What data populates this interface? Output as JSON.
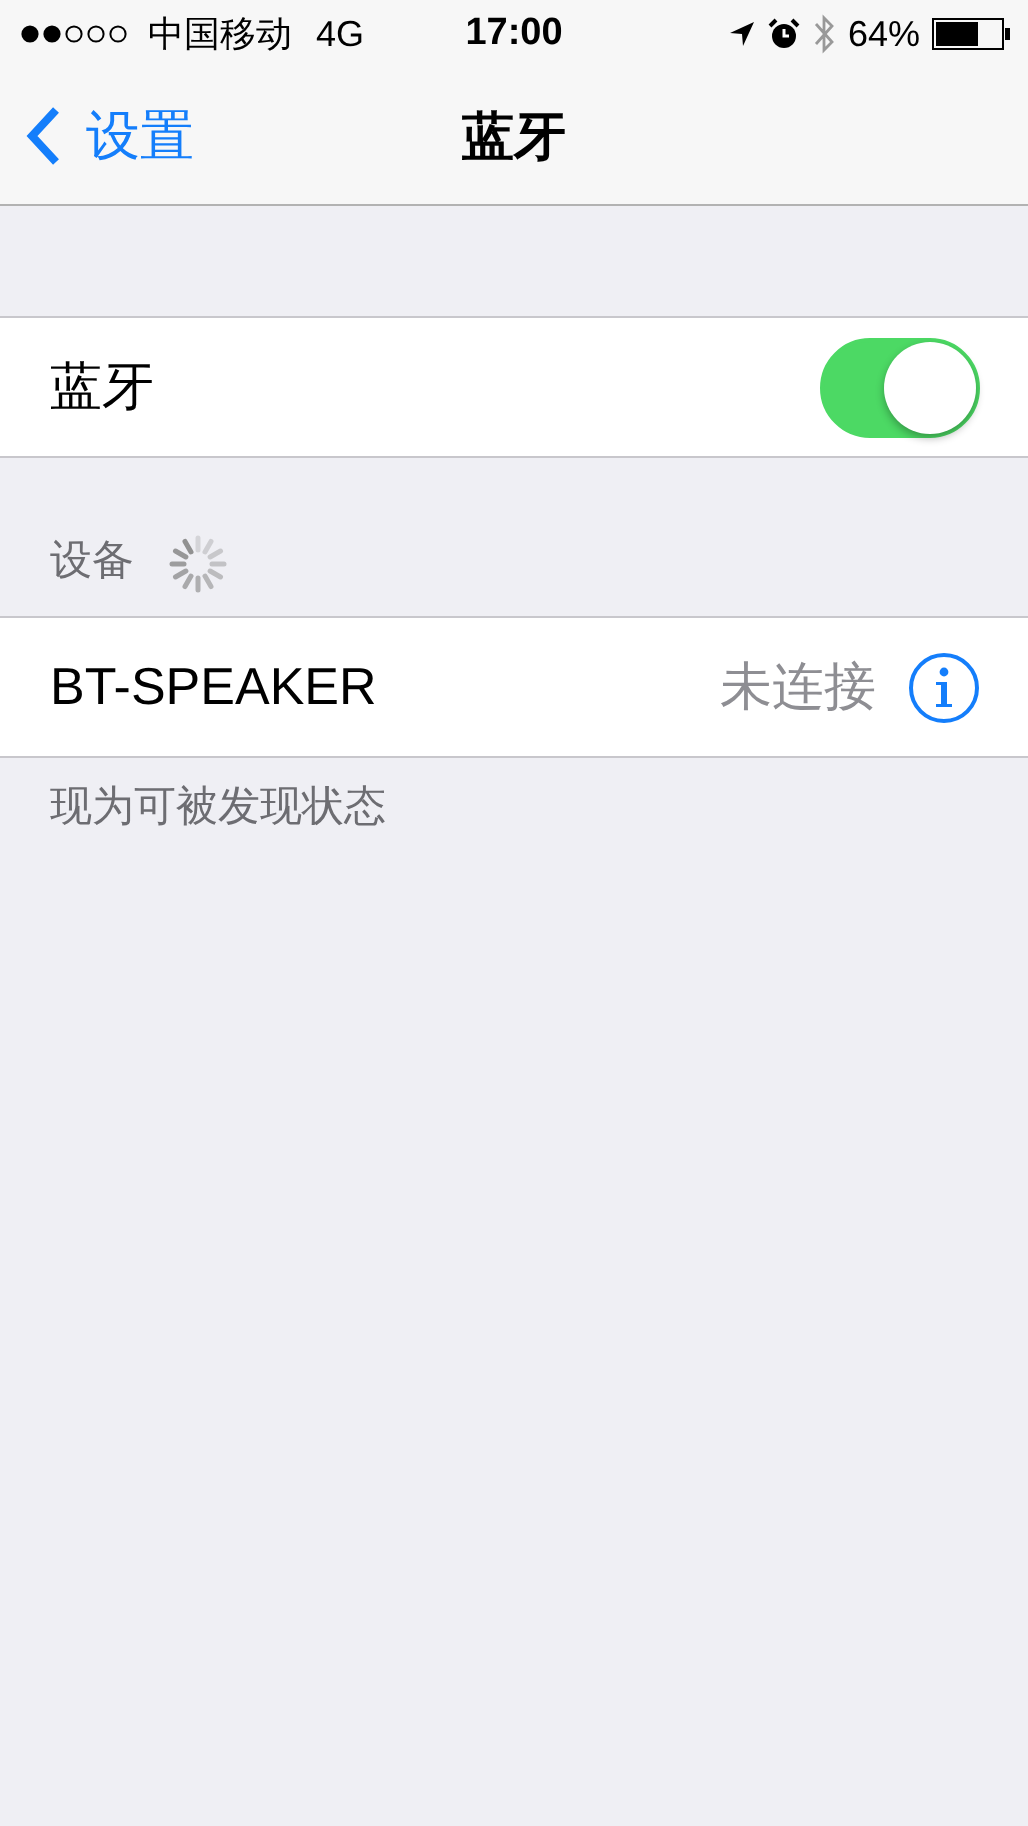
{
  "status_bar": {
    "carrier": "中国移动",
    "network": "4G",
    "time": "17:00",
    "battery": "64%"
  },
  "nav": {
    "back": "设置",
    "title": "蓝牙"
  },
  "toggle_row": {
    "label": "蓝牙",
    "on": true
  },
  "section": {
    "header": "设备",
    "searching": true
  },
  "devices": [
    {
      "name": "BT-SPEAKER",
      "status": "未连接"
    }
  ],
  "footer": "现为可被发现状态"
}
